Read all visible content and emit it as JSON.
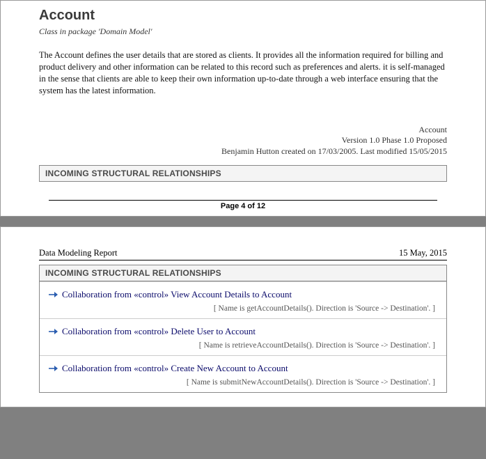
{
  "page1": {
    "title": "Account",
    "subtitle": "Class in package 'Domain Model'",
    "description": "The Account defines the user details that are stored as clients.  It provides all the information required for billing and product delivery and other information can be related to this record such as preferences and alerts. it is self-managed in the sense that clients are able to keep their own information up-to-date through a web interface ensuring that the system has the latest information.",
    "meta": {
      "name": "Account",
      "version_line": "Version 1.0  Phase 1.0  Proposed",
      "author_line": "Benjamin Hutton created on 17/03/2005.  Last modified 15/05/2015"
    },
    "section_header": "INCOMING STRUCTURAL RELATIONSHIPS",
    "footer": "Page  4 of 12"
  },
  "page2": {
    "report_header_left": "Data Modeling Report",
    "report_header_right": "15 May, 2015",
    "section_header": "INCOMING STRUCTURAL RELATIONSHIPS",
    "relationships": [
      {
        "line1": "Collaboration  from «control» View Account Details to  Account",
        "line2": "[ Name is getAccountDetails().  Direction is 'Source -> Destination'. ]"
      },
      {
        "line1": "Collaboration  from «control» Delete User to  Account",
        "line2": "[ Name is retrieveAccountDetails().  Direction is 'Source -> Destination'. ]"
      },
      {
        "line1": "Collaboration  from «control» Create New Account to  Account",
        "line2": "[ Name is submitNewAccountDetails().  Direction is 'Source -> Destination'. ]"
      }
    ]
  }
}
